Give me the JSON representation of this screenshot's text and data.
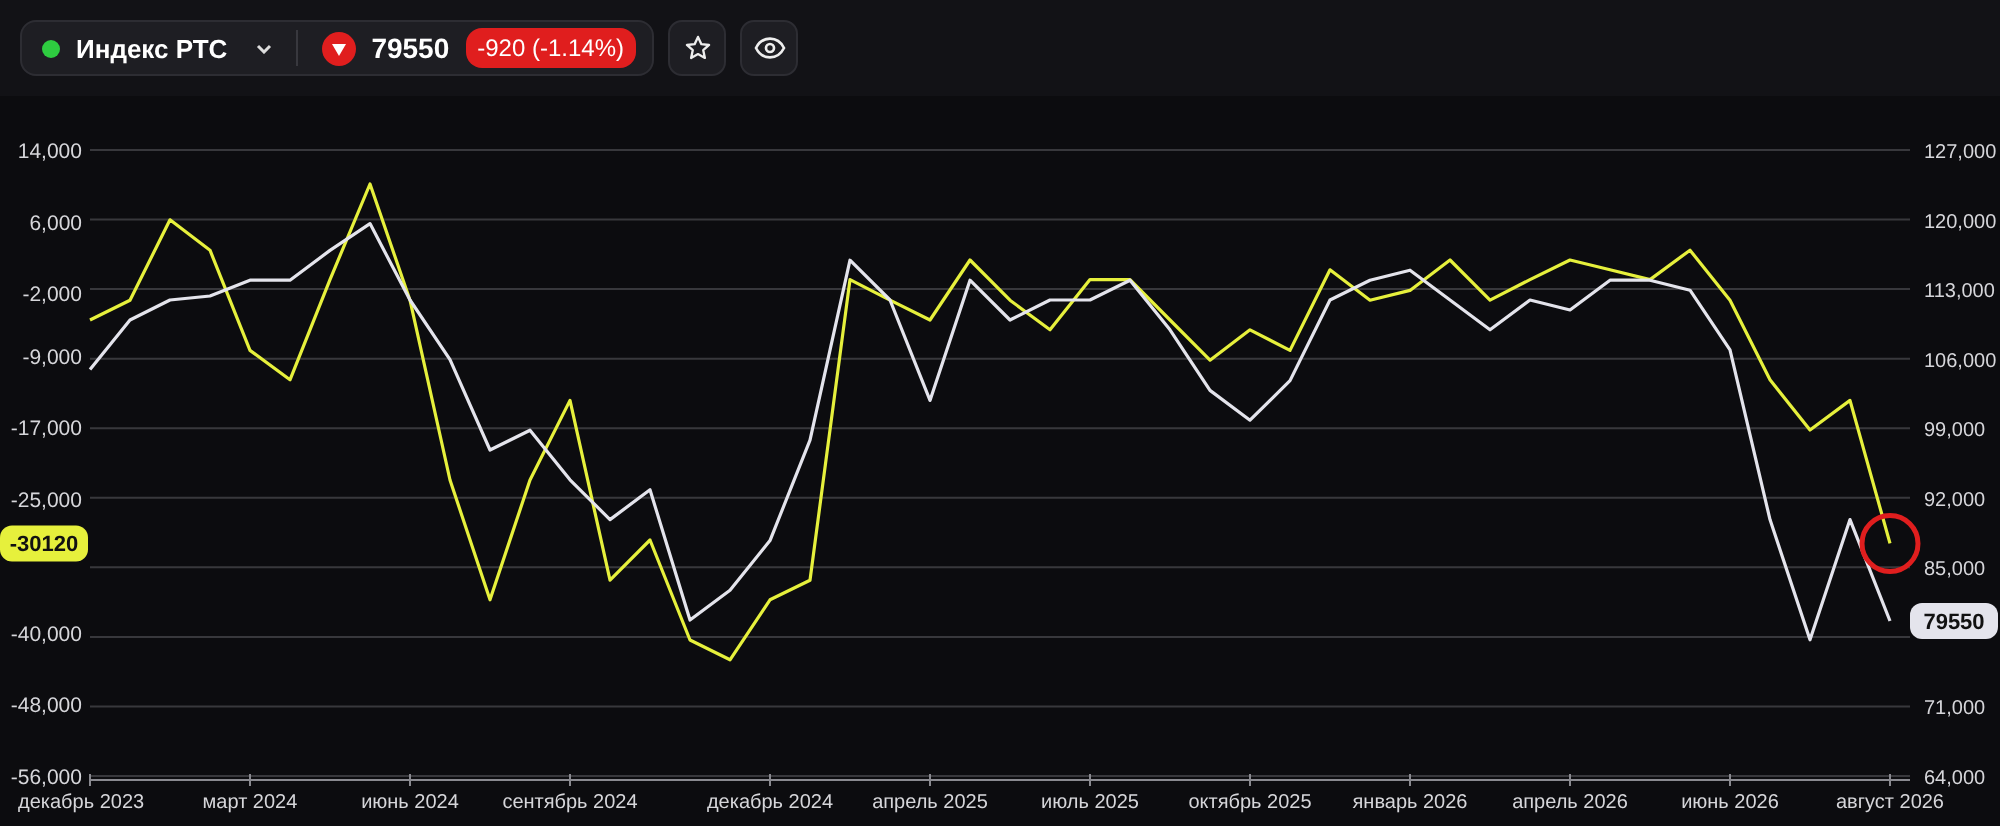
{
  "instrument": {
    "name": "Индекс РТС",
    "online": true
  },
  "price": {
    "falling": true,
    "value": "79550",
    "change": "-920 (-1.14%)"
  },
  "actions": [
    {
      "kind": "favorite"
    },
    {
      "kind": "watch"
    }
  ],
  "chart": {
    "chart_data": {
      "type": "line",
      "categories": [
        "декабрь 2023",
        null,
        null,
        null,
        "март 2024",
        null,
        null,
        null,
        "июнь 2024",
        null,
        null,
        null,
        "сентябрь 2024",
        null,
        null,
        null,
        null,
        "декабрь 2024",
        null,
        null,
        null,
        "апрель 2025",
        null,
        null,
        null,
        "июль 2025",
        null,
        null,
        null,
        "октябрь 2025",
        null,
        null,
        null,
        "январь 2026",
        null,
        null,
        null,
        "апрель 2026",
        null,
        null,
        null,
        "июнь 2026",
        null,
        null,
        null,
        "август 2026"
      ],
      "ylim": [
        -56000,
        14000
      ],
      "yticks": [
        {
          "value": 14000,
          "label": "14,000"
        },
        {
          "value": 6000,
          "label": "6,000"
        },
        {
          "value": -2000,
          "label": "-2,000"
        },
        {
          "value": -9000,
          "label": "-9,000"
        },
        {
          "value": -17000,
          "label": "-17,000"
        },
        {
          "value": -25000,
          "label": "-25,000"
        },
        {
          "value": -40000,
          "label": "-40,000"
        },
        {
          "value": -48000,
          "label": "-48,000"
        },
        {
          "value": -56000,
          "label": "-56,000"
        }
      ],
      "y2lim": [
        64000,
        127000
      ],
      "y2ticks": [
        {
          "value": 127000,
          "label": "127,000"
        },
        {
          "value": 120000,
          "label": "120,000"
        },
        {
          "value": 113000,
          "label": "113,000"
        },
        {
          "value": 106000,
          "label": "106,000"
        },
        {
          "value": 99000,
          "label": "99,000"
        },
        {
          "value": 92000,
          "label": "92,000"
        },
        {
          "value": 85000,
          "label": "85,000"
        },
        {
          "value": 71000,
          "label": "71,000"
        },
        {
          "value": 64000,
          "label": "64,000"
        }
      ],
      "series": [
        {
          "color": "#e6f03c",
          "values": [
            -5000,
            -2800,
            6200,
            2800,
            -8400,
            -11700,
            -500,
            10200,
            -2800,
            -22900,
            -36300,
            -22900,
            -14000,
            -34100,
            -29600,
            -40800,
            -43000,
            -36300,
            -34100,
            -500,
            -2800,
            -5000,
            1700,
            -2800,
            -6100,
            -500,
            -500,
            -5000,
            -9500,
            -6100,
            -8400,
            600,
            -2800,
            -1700,
            1700,
            -2800,
            -500,
            1700,
            600,
            -500,
            2800,
            -2800,
            -11700,
            -17300,
            -14000,
            -30000
          ]
        },
        {
          "axis": "y2",
          "color": "#e4e4ec",
          "values": [
            104900,
            109900,
            111900,
            112300,
            113900,
            113900,
            116900,
            119600,
            111900,
            105900,
            96800,
            98800,
            93800,
            89800,
            92800,
            79700,
            82700,
            87700,
            97800,
            115900,
            111900,
            101800,
            113900,
            109900,
            111900,
            111900,
            113900,
            108900,
            102800,
            99800,
            103800,
            111900,
            113900,
            114900,
            111900,
            108900,
            111900,
            110900,
            113900,
            113900,
            112900,
            106900,
            89800,
            77700,
            89800,
            79600
          ]
        }
      ],
      "grid": true
    },
    "value_badges": [
      {
        "text": "-30120",
        "circled": true
      },
      {
        "text": "79550",
        "circled": false
      }
    ]
  }
}
